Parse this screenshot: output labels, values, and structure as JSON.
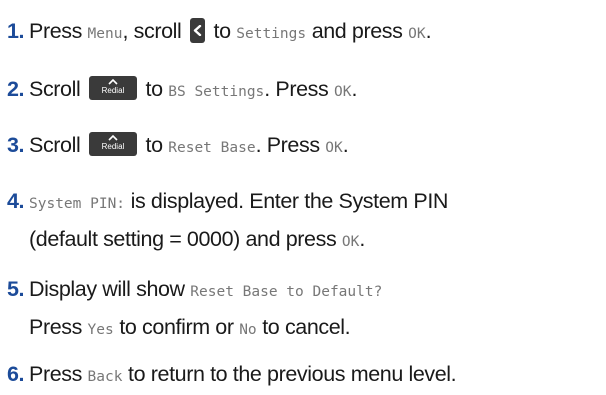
{
  "steps": [
    {
      "number": "1.",
      "p1": "Press",
      "menu": "Menu",
      "p2": ", scroll",
      "key_icon": "left-arrow-key-icon",
      "p3": "to",
      "settings": "Settings",
      "p4": "and press",
      "ok": "OK",
      "p5": "."
    },
    {
      "number": "2.",
      "p1": "Scroll",
      "key_icon": "redial-up-key-icon",
      "key_label": "Redial",
      "p2": "to",
      "target": "BS Settings",
      "p3": ". Press",
      "ok": "OK",
      "p4": "."
    },
    {
      "number": "3.",
      "p1": "Scroll",
      "key_icon": "redial-up-key-icon",
      "key_label": "Redial",
      "p2": "to",
      "target": "Reset Base",
      "p3": ". Press",
      "ok": "OK",
      "p4": "."
    },
    {
      "number": "4.",
      "mono1": "System PIN:",
      "p1": "is displayed. Enter the System PIN",
      "line2": "(default setting = 0000) and press",
      "ok": "OK",
      "p2": "."
    },
    {
      "number": "5.",
      "p1": "Display will show",
      "mono1": "Reset Base to Default?",
      "p2": "Press",
      "yes": "Yes",
      "p3": "to confirm or",
      "no": "No",
      "p4": "to cancel."
    },
    {
      "number": "6.",
      "p1": "Press",
      "back": "Back",
      "p2": "to return to the previous menu level."
    }
  ]
}
